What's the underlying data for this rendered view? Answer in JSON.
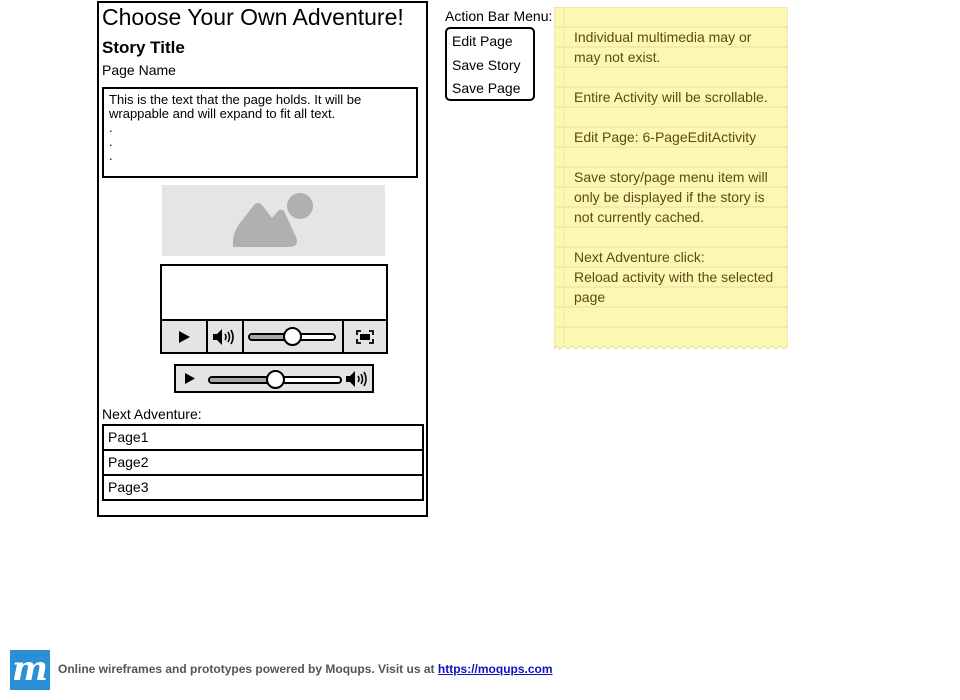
{
  "wireframe": {
    "app_title": "Choose Your Own Adventure!",
    "story_title": "Story Title",
    "page_name": "Page Name",
    "page_text": "This is the text that the page holds. It will be wrappable and will expand to fit all text.\n.\n.\n.",
    "image_icon": "image-placeholder-icon",
    "video_player": {
      "play_icon": "play-icon",
      "volume_icon": "speaker-volume-icon",
      "fullscreen_icon": "fullscreen-icon",
      "progress": 0.5
    },
    "audio_player": {
      "play_icon": "play-icon",
      "volume_icon": "speaker-volume-icon",
      "progress": 0.5
    },
    "next_adventure_label": "Next Adventure:",
    "next_adventure_pages": [
      "Page1",
      "Page2",
      "Page3"
    ]
  },
  "action_bar": {
    "label": "Action Bar Menu:",
    "items": [
      "Edit Page",
      "Save Story",
      "Save Page"
    ]
  },
  "note": {
    "text": "Individual multimedia may or may not exist.\n\nEntire Activity will be scrollable.\n\nEdit Page: 6-PageEditActivity\n\nSave story/page menu item will only be displayed if the story is not currently cached.\n\nNext Adventure click:\nReload activity with the selected page",
    "color": "#fcf8b4"
  },
  "footer": {
    "logo_letter": "m",
    "text": "Online wireframes and prototypes powered by Moqups. Visit us at",
    "link_text": "https://moqups.com",
    "brand_color": "#2b8fd8"
  }
}
